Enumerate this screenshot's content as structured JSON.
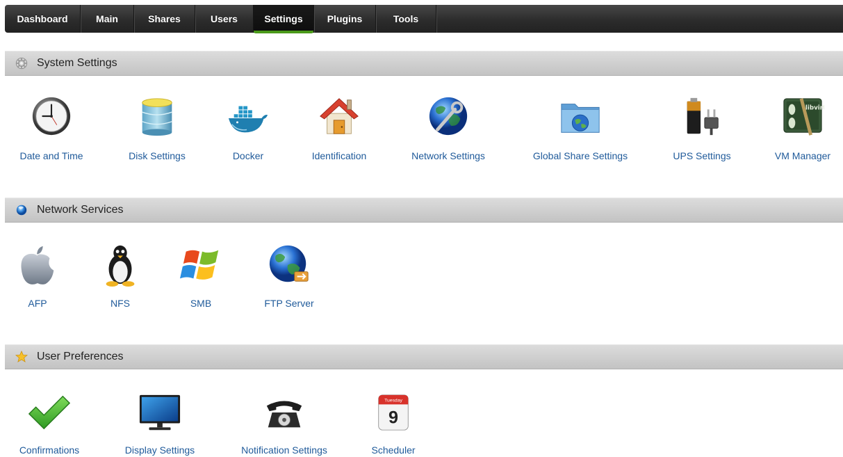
{
  "nav": {
    "tabs": [
      {
        "label": "Dashboard",
        "active": false
      },
      {
        "label": "Main",
        "active": false
      },
      {
        "label": "Shares",
        "active": false
      },
      {
        "label": "Users",
        "active": false
      },
      {
        "label": "Settings",
        "active": true
      },
      {
        "label": "Plugins",
        "active": false
      },
      {
        "label": "Tools",
        "active": false
      }
    ],
    "active_indicator_color": "#4b9a1a"
  },
  "sections": [
    {
      "title": "System Settings",
      "icon": "gear-icon",
      "items": [
        {
          "label": "Date and Time",
          "icon": "clock-icon"
        },
        {
          "label": "Disk Settings",
          "icon": "disk-stack-icon"
        },
        {
          "label": "Docker",
          "icon": "docker-whale-icon"
        },
        {
          "label": "Identification",
          "icon": "house-icon"
        },
        {
          "label": "Network Settings",
          "icon": "globe-wrench-icon"
        },
        {
          "label": "Global Share Settings",
          "icon": "globe-folder-icon"
        },
        {
          "label": "UPS Settings",
          "icon": "battery-plug-icon"
        },
        {
          "label": "VM Manager",
          "icon": "libvirt-icon"
        }
      ]
    },
    {
      "title": "Network Services",
      "icon": "blue-orb-icon",
      "items": [
        {
          "label": "AFP",
          "icon": "apple-icon"
        },
        {
          "label": "NFS",
          "icon": "penguin-icon"
        },
        {
          "label": "SMB",
          "icon": "windows-flag-icon"
        },
        {
          "label": "FTP Server",
          "icon": "globe-transfer-icon"
        }
      ]
    },
    {
      "title": "User Preferences",
      "icon": "star-icon",
      "items": [
        {
          "label": "Confirmations",
          "icon": "checkmark-icon"
        },
        {
          "label": "Display Settings",
          "icon": "monitor-icon"
        },
        {
          "label": "Notification Settings",
          "icon": "telephone-icon"
        },
        {
          "label": "Scheduler",
          "icon": "calendar-icon",
          "calendar_weekday": "Tuesday",
          "calendar_day": "9"
        }
      ]
    }
  ],
  "item_label_color": "#1f5a9a",
  "vm_icon_text": "libvirt"
}
